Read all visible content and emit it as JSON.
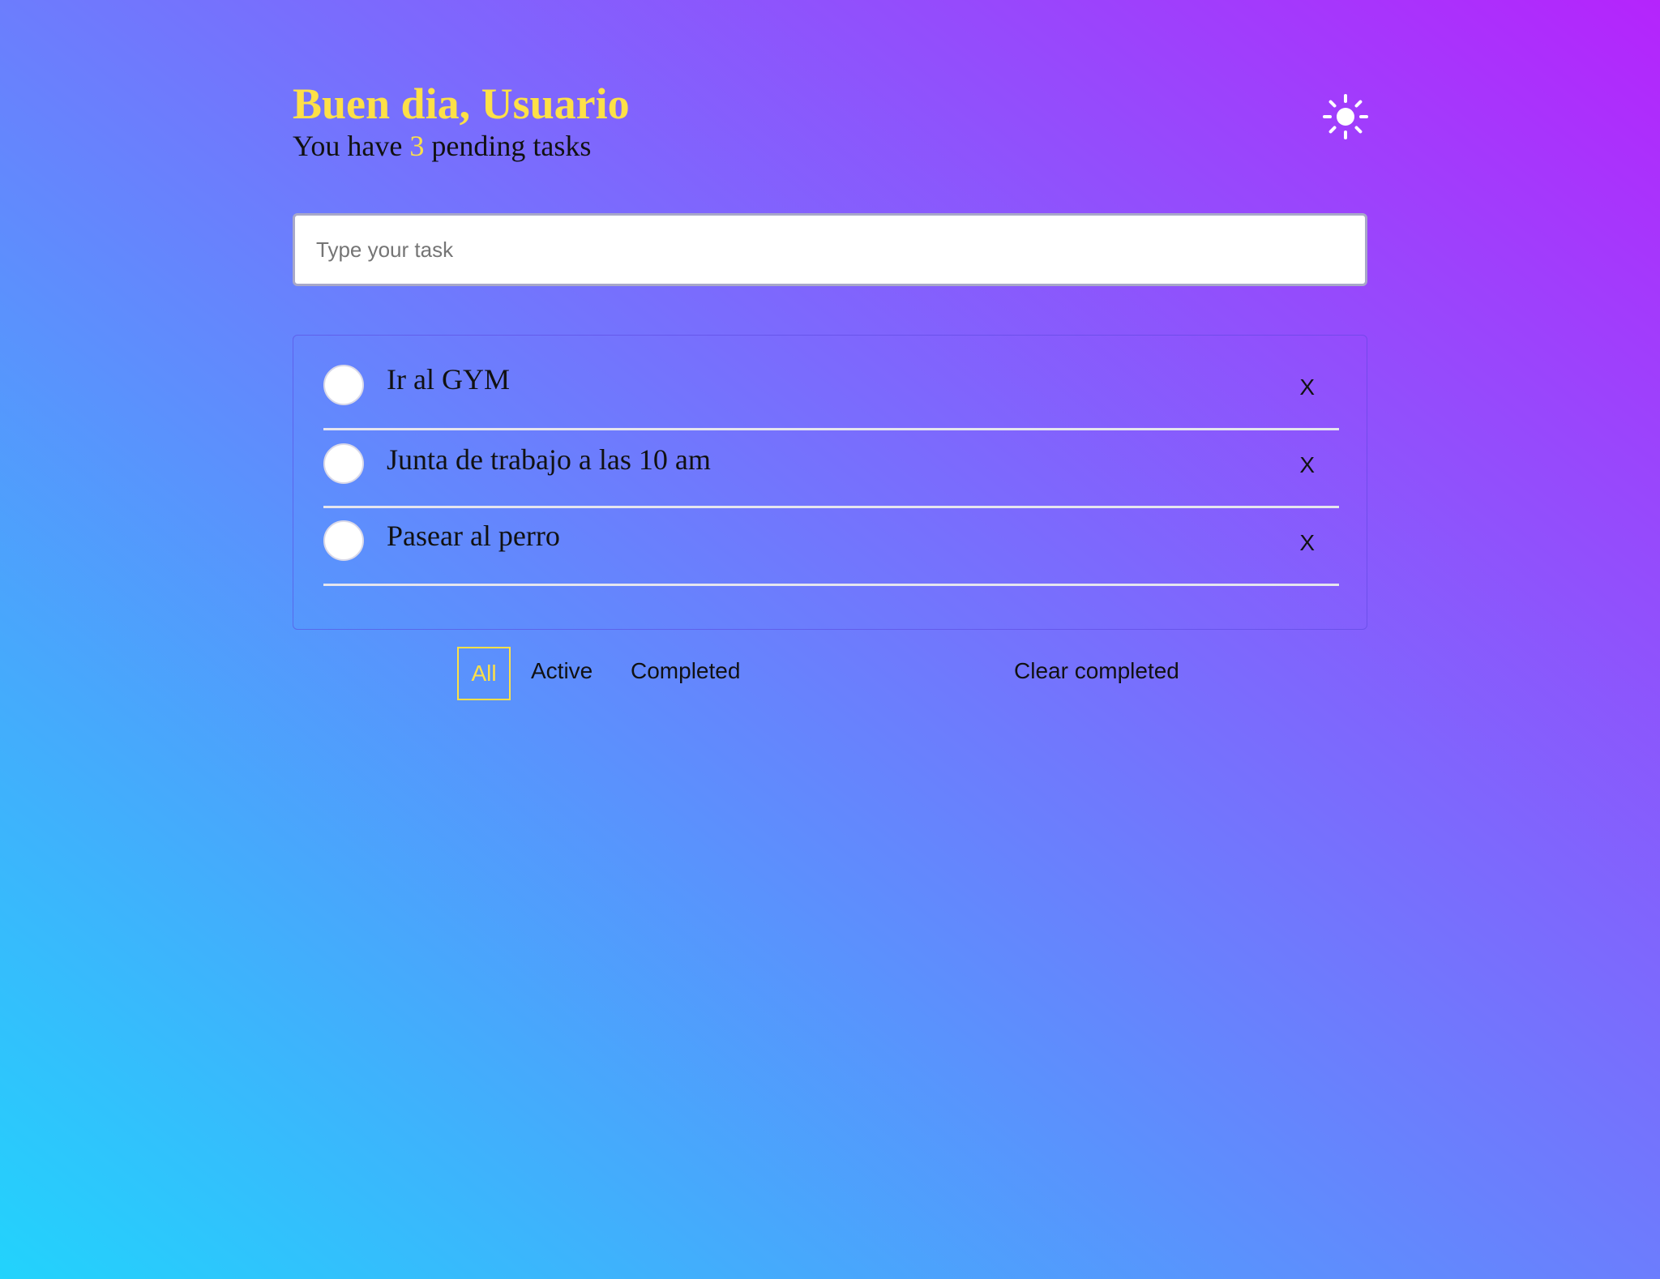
{
  "header": {
    "greeting": "Buen dia, Usuario",
    "pending_prefix": "You have ",
    "pending_count": "3",
    "pending_suffix": " pending tasks"
  },
  "theme_toggle": {
    "icon": "sun-icon"
  },
  "new_task": {
    "placeholder": "Type your task",
    "value": ""
  },
  "tasks": [
    {
      "text": "Ir al GYM",
      "completed": false,
      "delete_label": "X"
    },
    {
      "text": "Junta de trabajo a las 10 am",
      "completed": false,
      "delete_label": "X"
    },
    {
      "text": "Pasear al perro",
      "completed": false,
      "delete_label": "X"
    }
  ],
  "filters": {
    "items": [
      "All",
      "Active",
      "Completed"
    ],
    "selected": "All",
    "clear_label": "Clear completed"
  },
  "colors": {
    "accent": "#fde047",
    "gradient_start": "#22d3fc",
    "gradient_end": "#b524fc"
  }
}
